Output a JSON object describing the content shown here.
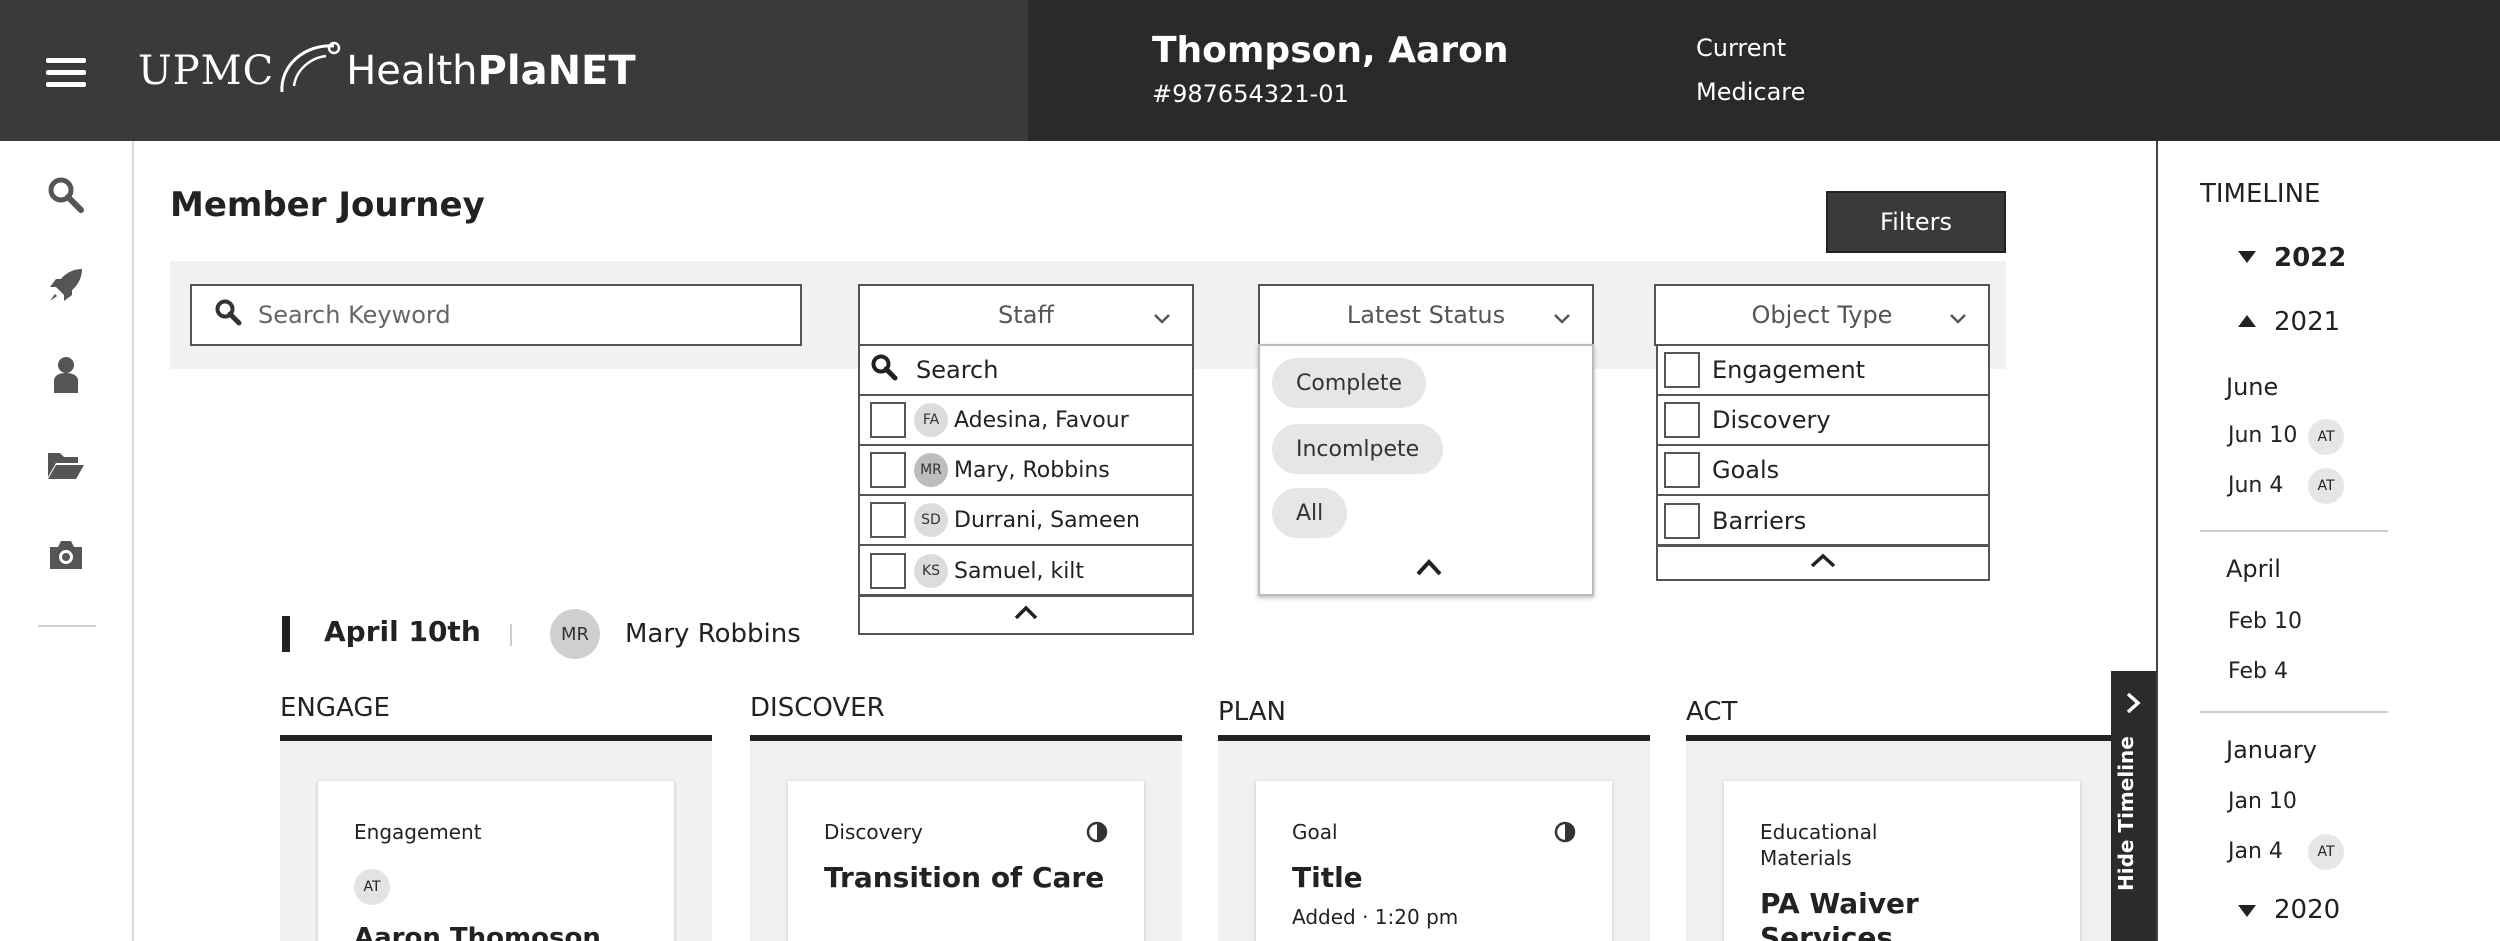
{
  "header": {
    "logo_upmc": "UPMC",
    "logo_health": "Health",
    "logo_planet": "PlaNET",
    "patient_name": "Thompson, Aaron",
    "patient_id": "#987654321-01",
    "coverage_status": "Current",
    "coverage_plan": "Medicare"
  },
  "left_rail": {
    "icons": [
      "search-icon",
      "rocket-icon",
      "person-icon",
      "folder-open-icon",
      "camera-icon"
    ]
  },
  "main": {
    "title": "Member Journey",
    "filters_label": "Filters",
    "search_placeholder": "Search Keyword",
    "staff": {
      "label": "Staff",
      "search_label": "Search",
      "people": [
        {
          "initials": "FA",
          "name": "Adesina, Favour"
        },
        {
          "initials": "MR",
          "name": "Mary, Robbins"
        },
        {
          "initials": "SD",
          "name": "Durrani, Sameen"
        },
        {
          "initials": "KS",
          "name": "Samuel, kilt"
        }
      ]
    },
    "status": {
      "label": "Latest Status",
      "options": [
        "Complete",
        "Incomlpete",
        "All"
      ]
    },
    "object_type": {
      "label": "Object Type",
      "options": [
        "Engagement",
        "Discovery",
        "Goals",
        "Barriers"
      ]
    },
    "entry": {
      "date": "April 10th",
      "owner_initials": "MR",
      "owner_name": "Mary Robbins"
    },
    "phases": [
      "ENGAGE",
      "DISCOVER",
      "PLAN",
      "ACT"
    ],
    "cards": [
      {
        "type": "Engagement",
        "badge": "AT",
        "title": "Aaron Thomoson"
      },
      {
        "type": "Discovery",
        "title": "Transition of Care"
      },
      {
        "type": "Goal",
        "title": "Title",
        "meta": "Added · 1:20 pm"
      },
      {
        "type_line1": "Educational",
        "type_line2": "Materials",
        "title_line1": "PA Waiver",
        "title_line2": "Services"
      }
    ],
    "hide_timeline_label": "Hide Timeline"
  },
  "timeline": {
    "title": "TIMELINE",
    "year_2022": "2022",
    "year_2021": "2021",
    "year_2020": "2020",
    "june": {
      "label": "June",
      "days": [
        {
          "label": "Jun 10",
          "badge": "AT"
        },
        {
          "label": "Jun 4",
          "badge": "AT"
        }
      ]
    },
    "april": {
      "label": "April",
      "days": [
        {
          "label": "Feb 10"
        },
        {
          "label": "Feb 4"
        }
      ]
    },
    "january": {
      "label": "January",
      "days": [
        {
          "label": "Jan 10"
        },
        {
          "label": "Jan 4",
          "badge": "AT"
        }
      ]
    }
  }
}
